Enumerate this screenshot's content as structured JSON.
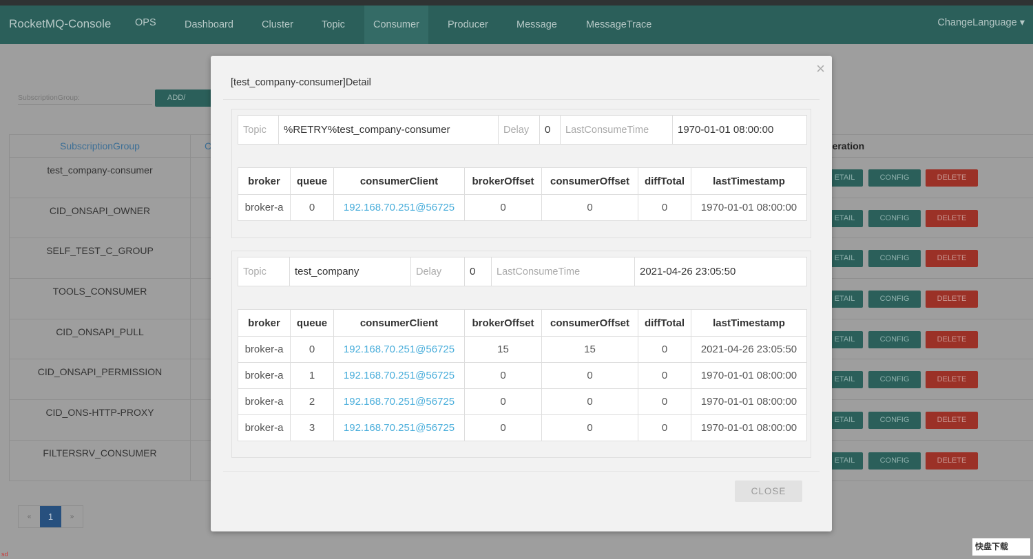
{
  "nav": {
    "brand": "RocketMQ-Console",
    "items": [
      "OPS",
      "Dashboard",
      "Cluster",
      "Topic",
      "Consumer",
      "Producer",
      "Message",
      "MessageTrace"
    ],
    "active": "Consumer",
    "language": "ChangeLanguage ▾"
  },
  "toolbar": {
    "subscription_label": "SubscriptionGroup:",
    "add_update": "ADD/ UPDATE"
  },
  "list": {
    "headers": {
      "group": "SubscriptionGroup",
      "col2": "C",
      "operation": "peration"
    },
    "groups": [
      "test_company-consumer",
      "CID_ONSAPI_OWNER",
      "SELF_TEST_C_GROUP",
      "TOOLS_CONSUMER",
      "CID_ONSAPI_PULL",
      "CID_ONSAPI_PERMISSION",
      "CID_ONS-HTTP-PROXY",
      "FILTERSRV_CONSUMER"
    ],
    "buttons": {
      "detail": "ETAIL",
      "config": "CONFIG",
      "delete": "DELETE"
    }
  },
  "pagination": {
    "prev": "«",
    "current": "1",
    "next": "»"
  },
  "watermark": {
    "corner": "sd",
    "logo": "快盘下载"
  },
  "modal": {
    "title": "[test_company-consumer]Detail",
    "close_x": "×",
    "close_button": "CLOSE",
    "labels": {
      "topic": "Topic",
      "delay": "Delay",
      "last": "LastConsumeTime"
    },
    "columns": [
      "broker",
      "queue",
      "consumerClient",
      "brokerOffset",
      "consumerOffset",
      "diffTotal",
      "lastTimestamp"
    ],
    "topics": [
      {
        "topic": "%RETRY%test_company-consumer",
        "delay": "0",
        "lastConsumeTime": "1970-01-01 08:00:00",
        "rows": [
          [
            "broker-a",
            "0",
            "192.168.70.251@56725",
            "0",
            "0",
            "0",
            "1970-01-01 08:00:00"
          ]
        ]
      },
      {
        "topic": "test_company",
        "delay": "0",
        "lastConsumeTime": "2021-04-26 23:05:50",
        "rows": [
          [
            "broker-a",
            "0",
            "192.168.70.251@56725",
            "15",
            "15",
            "0",
            "2021-04-26 23:05:50"
          ],
          [
            "broker-a",
            "1",
            "192.168.70.251@56725",
            "0",
            "0",
            "0",
            "1970-01-01 08:00:00"
          ],
          [
            "broker-a",
            "2",
            "192.168.70.251@56725",
            "0",
            "0",
            "0",
            "1970-01-01 08:00:00"
          ],
          [
            "broker-a",
            "3",
            "192.168.70.251@56725",
            "0",
            "0",
            "0",
            "1970-01-01 08:00:00"
          ]
        ]
      }
    ]
  },
  "colors": {
    "nav": "#2b5f5a",
    "link": "#4aaedb",
    "delete": "#9b3127",
    "page_active": "#27507e"
  }
}
